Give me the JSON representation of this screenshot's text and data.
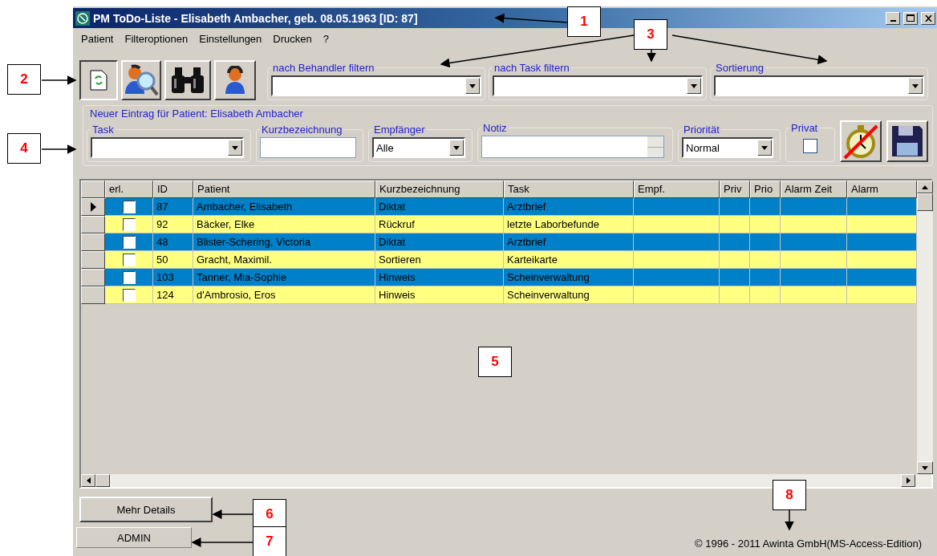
{
  "window": {
    "title": "PM ToDo-Liste -  Elisabeth Ambacher, geb. 08.05.1963 [ID: 87]"
  },
  "menu": [
    "Patient",
    "Filteroptionen",
    "Einstellungen",
    "Drucken",
    "?"
  ],
  "filters": [
    {
      "label": "nach Behandler filtern"
    },
    {
      "label": "nach Task filtern"
    },
    {
      "label": "Sortierung"
    }
  ],
  "new_entry": {
    "caption": "Neuer Eintrag für Patient: Elisabeth Ambacher",
    "fields": [
      {
        "kind": "combo",
        "label": "Task"
      },
      {
        "kind": "text",
        "label": "Kurzbezeichnung"
      },
      {
        "kind": "combo",
        "label": "Empfänger",
        "value": "Alle"
      },
      {
        "kind": "spin",
        "label": "Notiz"
      },
      {
        "kind": "combo",
        "label": "Priorität",
        "value": "Normal"
      },
      {
        "kind": "checkbox",
        "label": "Privat",
        "checked": false
      }
    ]
  },
  "table": {
    "columns": [
      "erl.",
      "ID",
      "Patient",
      "Kurzbezeichnung",
      "Task",
      "Empf.",
      "Priv",
      "Prio",
      "Alarm Zeit",
      "Alarm"
    ],
    "rows": [
      {
        "current": true,
        "color": "#0080c8",
        "done": false,
        "cells": [
          "",
          "87",
          "Ambacher, Elisabeth",
          "Diktat",
          "Arztbrief",
          "",
          "",
          "",
          "",
          ""
        ]
      },
      {
        "current": false,
        "color": "#ffff80",
        "done": false,
        "cells": [
          "",
          "92",
          "Bäcker, Elke",
          "Rückruf",
          "letzte Laborbefunde",
          "",
          "",
          "",
          "",
          ""
        ]
      },
      {
        "current": false,
        "color": "#0080c8",
        "done": false,
        "cells": [
          "",
          "48",
          "Blister-Schering, Victoria",
          "Diktat",
          "Arztbrief",
          "",
          "",
          "",
          "",
          ""
        ]
      },
      {
        "current": false,
        "color": "#ffff80",
        "done": false,
        "cells": [
          "",
          "50",
          "Gracht, Maximil.",
          "Sortieren",
          "Karteikarte",
          "",
          "",
          "",
          "",
          ""
        ]
      },
      {
        "current": false,
        "color": "#0080c8",
        "done": false,
        "cells": [
          "",
          "103",
          "Tanner, Mia-Sophie",
          "Hinweis",
          "Scheinverwaltung",
          "",
          "",
          "",
          "",
          ""
        ]
      },
      {
        "current": false,
        "color": "#ffff80",
        "done": false,
        "cells": [
          "",
          "124",
          "d'Ambrosio, Eros",
          "Hinweis",
          "Scheinverwaltung",
          "",
          "",
          "",
          "",
          ""
        ]
      }
    ]
  },
  "details_button": "Mehr Details",
  "user": "ADMIN",
  "copyright": "© 1996 - 2011 Awinta GmbH(MS-Access-Edition)",
  "callouts": [
    "1",
    "2",
    "3",
    "4",
    "5",
    "6",
    "7",
    "8"
  ]
}
